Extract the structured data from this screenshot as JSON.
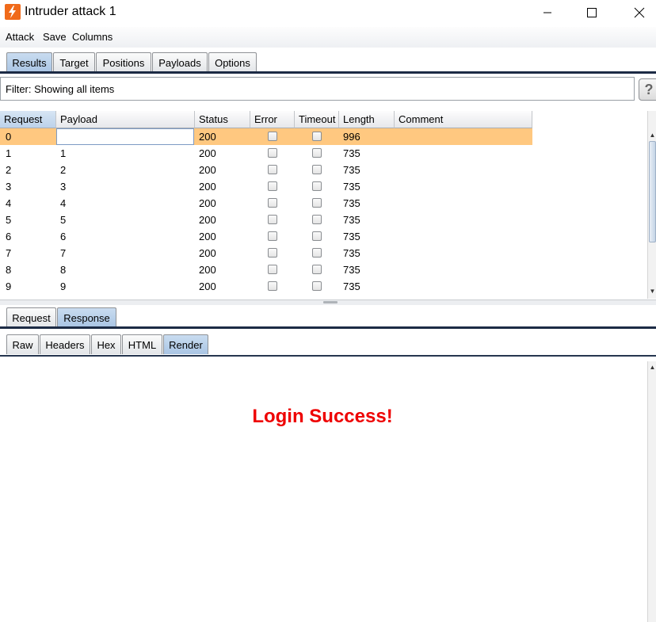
{
  "window": {
    "title": "Intruder attack 1"
  },
  "menu": [
    "Attack",
    "Save",
    "Columns"
  ],
  "main_tabs": [
    "Results",
    "Target",
    "Positions",
    "Payloads",
    "Options"
  ],
  "filter": {
    "text": "Filter: Showing all items",
    "help": "?"
  },
  "table": {
    "columns": [
      "Request",
      "Payload",
      "Status",
      "Error",
      "Timeout",
      "Length",
      "Comment"
    ],
    "sort_indicator": "▲",
    "rows": [
      {
        "request": "0",
        "payload": "",
        "status": "200",
        "length": "996",
        "selected": true
      },
      {
        "request": "1",
        "payload": "1",
        "status": "200",
        "length": "735"
      },
      {
        "request": "2",
        "payload": "2",
        "status": "200",
        "length": "735"
      },
      {
        "request": "3",
        "payload": "3",
        "status": "200",
        "length": "735"
      },
      {
        "request": "4",
        "payload": "4",
        "status": "200",
        "length": "735"
      },
      {
        "request": "5",
        "payload": "5",
        "status": "200",
        "length": "735"
      },
      {
        "request": "6",
        "payload": "6",
        "status": "200",
        "length": "735"
      },
      {
        "request": "7",
        "payload": "7",
        "status": "200",
        "length": "735"
      },
      {
        "request": "8",
        "payload": "8",
        "status": "200",
        "length": "735"
      },
      {
        "request": "9",
        "payload": "9",
        "status": "200",
        "length": "735"
      }
    ]
  },
  "detail_tabs": [
    "Request",
    "Response"
  ],
  "view_tabs": [
    "Raw",
    "Headers",
    "Hex",
    "HTML",
    "Render"
  ],
  "render": {
    "message": "Login Success!",
    "message_color": "#ee0000"
  },
  "colors": {
    "selected_row": "#ffc880",
    "active_tab": "#b5cde8",
    "accent_line": "#1c2b45"
  },
  "icons": {
    "app": "burp-lightning-icon",
    "minimize": "minimize-icon",
    "maximize": "maximize-icon",
    "close": "close-icon"
  }
}
